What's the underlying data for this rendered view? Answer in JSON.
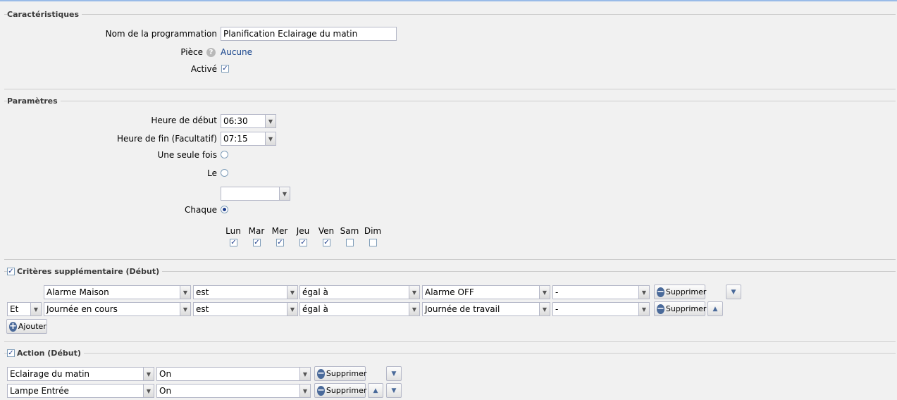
{
  "caracteristiques": {
    "legend": "Caractéristiques",
    "nom_label": "Nom de la programmation",
    "nom_value": "Planification Eclairage du matin",
    "piece_label": "Pièce",
    "piece_value": "Aucune",
    "actif_label": "Activé",
    "actif_checked": true
  },
  "parametres": {
    "legend": "Paramètres",
    "heure_debut_label": "Heure de début",
    "heure_debut_value": "06:30",
    "heure_fin_label": "Heure de fin (Facultatif)",
    "heure_fin_value": "07:15",
    "une_seule_fois_label": "Une seule fois",
    "le_label": "Le",
    "le_value": "",
    "chaque_label": "Chaque",
    "mode_selected": "Chaque",
    "days": [
      {
        "label": "Lun",
        "checked": true
      },
      {
        "label": "Mar",
        "checked": true
      },
      {
        "label": "Mer",
        "checked": true
      },
      {
        "label": "Jeu",
        "checked": true
      },
      {
        "label": "Ven",
        "checked": true
      },
      {
        "label": "Sam",
        "checked": false
      },
      {
        "label": "Dim",
        "checked": false
      }
    ]
  },
  "criteres": {
    "legend": "Critères supplémentaire (Début)",
    "checked": true,
    "rows": [
      {
        "connector": "",
        "field": "Alarme Maison",
        "verb": "est",
        "op": "égal à",
        "value": "Alarme OFF",
        "extra": "-",
        "delete_label": "Supprimer"
      },
      {
        "connector": "Et",
        "field": "Journée en cours",
        "verb": "est",
        "op": "égal à",
        "value": "Journée de travail",
        "extra": "-",
        "delete_label": "Supprimer"
      }
    ],
    "add_label": "Ajouter"
  },
  "action": {
    "legend": "Action (Début)",
    "checked": true,
    "rows": [
      {
        "device": "Eclairage du matin",
        "command": "On",
        "delete_label": "Supprimer"
      },
      {
        "device": "Lampe Entrée",
        "command": "On",
        "delete_label": "Supprimer"
      }
    ]
  },
  "colors": {
    "accent": "#15428b",
    "border": "#b5b8c8",
    "background": "#f1f1f1"
  }
}
